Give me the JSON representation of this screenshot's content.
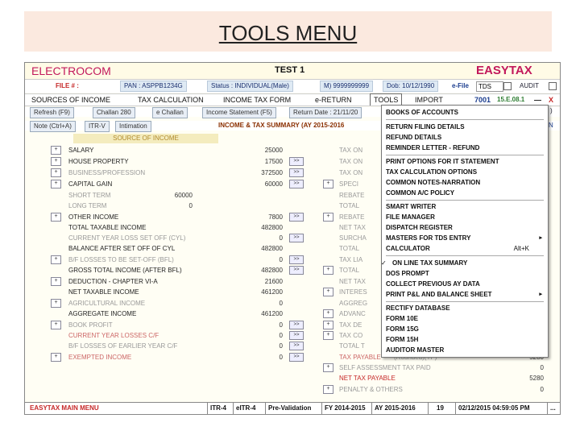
{
  "slide": {
    "title": "TOOLS MENU"
  },
  "header": {
    "left_brand": "ELECTROCOM",
    "center_title": "TEST 1",
    "right_brand": "EASYTAX"
  },
  "info": {
    "file_label": "FILE # :",
    "pan": "PAN : ASPPB1234G",
    "status": "Status : INDIVIDUAL(Male)",
    "mobile": "M) 9999999999",
    "dob": "Dob: 10/12/1990",
    "efile": "e-File",
    "tds": "TDS",
    "audit": "AUDIT"
  },
  "menubar": {
    "items": [
      "SOURCES OF INCOME",
      "TAX CALCULATION",
      "INCOME TAX FORM",
      "e-RETURN",
      "TOOLS",
      "IMPORT"
    ],
    "code": "7001",
    "version": "15.E.08.1",
    "minimize": "—",
    "close": "X"
  },
  "toolbar1": {
    "refresh": "Refresh (F9)",
    "challan": "Challan 280",
    "echallan": "e Challan",
    "income_stmt": "Income Statement (F5)",
    "return_date": "Return Date : 21/11/20",
    "right_edge": ")"
  },
  "toolbar2": {
    "note": "Note (Ctrl+A)",
    "itrv": "ITR-V",
    "intimation": "Intimation",
    "summary": "INCOME & TAX SUMMARY (AY 2015-2016",
    "right_edge": "N"
  },
  "source": {
    "header": "SOURCE OF INCOME",
    "rows": [
      {
        "label": "SALARY",
        "value": "25000"
      },
      {
        "label": "HOUSE PROPERTY",
        "value": "17500"
      },
      {
        "label": "BUSINESS/PROFESSION",
        "value": "372500"
      },
      {
        "label": "CAPITAL GAIN",
        "value": "60000"
      },
      {
        "label": "SHORT TERM",
        "value": "60000"
      },
      {
        "label": "LONG TERM",
        "value": "0"
      },
      {
        "label": "OTHER INCOME",
        "value": "7800"
      },
      {
        "label": "TOTAL TAXABLE INCOME",
        "value": "482800"
      },
      {
        "label": "CURRENT YEAR LOSS SET OFF (CYL)",
        "value": "0"
      },
      {
        "label": "BALANCE AFTER SET OFF OF CYL",
        "value": "482800"
      },
      {
        "label": "B/F LOSSES TO BE SET-OFF (BFL)",
        "value": "0"
      },
      {
        "label": "GROSS TOTAL INCOME (AFTER BFL)",
        "value": "482800"
      },
      {
        "label": "DEDUCTION - CHAPTER VI-A",
        "value": "21600"
      },
      {
        "label": "NET TAXABLE INCOME",
        "value": "461200"
      },
      {
        "label": "AGRICULTURAL INCOME",
        "value": "0"
      },
      {
        "label": "AGGREGATE INCOME",
        "value": "461200"
      },
      {
        "label": "BOOK PROFIT",
        "value": "0"
      },
      {
        "label": "CURRENT YEAR LOSSES C/F",
        "value": "0"
      },
      {
        "label": "B/F LOSSES OF EARLIER YEAR C/F",
        "value": "0"
      },
      {
        "label": "EXEMPTED INCOME",
        "value": "0"
      }
    ]
  },
  "right_col": {
    "labels": [
      "TAX ON",
      "TAX ON",
      "TAX ON",
      "SPECI",
      "REBATE",
      "TOTAL",
      "REBATE",
      "NET TAX",
      "SURCHA",
      "TOTAL",
      "TAX LIA",
      "TOTAL",
      "NET TAX",
      "INTERES",
      "AGGREG",
      "ADVANC",
      "TAX DE",
      "TAX CO",
      "TOTAL T"
    ],
    "tax_payable": "TAX PAYABLE",
    "rounded": "(Rounded)(TP)",
    "tax_payable_val": "5280",
    "self_assess": "SELF ASSESSMENT TAX PAID",
    "self_assess_val": "0",
    "net_payable": "NET TAX PAYABLE",
    "net_payable_val": "5280",
    "penalty": "PENALTY & OTHERS",
    "penalty_val": "0"
  },
  "tools_menu": {
    "items": [
      {
        "label": "BOOKS OF ACCOUNTS"
      },
      {
        "label": "RETURN FILING DETAILS"
      },
      {
        "label": "REFUND DETAILS"
      },
      {
        "label": "REMINDER LETTER - REFUND"
      },
      {
        "label": "PRINT OPTIONS FOR IT STATEMENT"
      },
      {
        "label": "TAX CALCULATION OPTIONS"
      },
      {
        "label": "COMMON NOTES-NARRATION"
      },
      {
        "label": "COMMON A/C POLICY"
      },
      {
        "label": "SMART WRITER"
      },
      {
        "label": "FILE MANAGER"
      },
      {
        "label": "DISPATCH REGISTER"
      },
      {
        "label": "MASTERS FOR TDS ENTRY"
      },
      {
        "label": "CALCULATOR",
        "shortcut": "Alt+K"
      },
      {
        "label": "ON LINE TAX SUMMARY"
      },
      {
        "label": "DOS PROMPT"
      },
      {
        "label": "COLLECT PREVIOUS AY DATA"
      },
      {
        "label": "PRINT P&L AND BALANCE SHEET"
      },
      {
        "label": "RECTIFY DATABASE"
      },
      {
        "label": "FORM 10E"
      },
      {
        "label": "FORM 15G"
      },
      {
        "label": "FORM 15H"
      },
      {
        "label": "AUDITOR MASTER"
      }
    ]
  },
  "statusbar": {
    "main_menu": "EASYTAX MAIN MENU",
    "itr": "ITR-4",
    "eitr": "eITR-4",
    "prevalidation": "Pre-Validation",
    "fy": "FY 2014-2015",
    "ay": "AY 2015-2016",
    "num": "19",
    "datetime": "02/12/2015 04:59:05 PM",
    "tail": "..."
  }
}
